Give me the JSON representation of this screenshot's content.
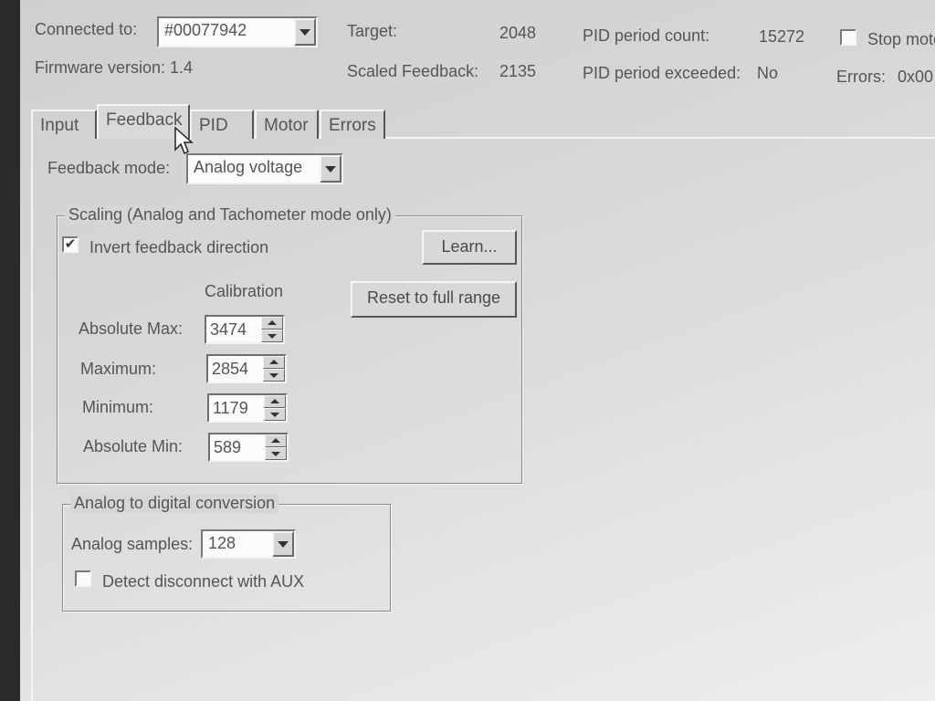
{
  "header": {
    "connected_label": "Connected to:",
    "device_serial": "#00077942",
    "firmware": "Firmware version: 1.4",
    "target_label": "Target:",
    "target_value": "2048",
    "scaled_label": "Scaled Feedback:",
    "scaled_value": "2135",
    "pid_count_label": "PID period count:",
    "pid_count_value": "15272",
    "pid_exceeded_label": "PID period exceeded:",
    "pid_exceeded_value": "No",
    "stop_label": "Stop moto",
    "errors_label": "Errors:",
    "errors_value": "0x00"
  },
  "tabs": [
    {
      "label": "Input"
    },
    {
      "label": "Feedback"
    },
    {
      "label": "PID"
    },
    {
      "label": "Motor"
    },
    {
      "label": "Errors"
    }
  ],
  "feedback": {
    "mode_label": "Feedback mode:",
    "mode_value": "Analog voltage",
    "scaling": {
      "caption": "Scaling (Analog and Tachometer mode only)",
      "invert_label": "Invert feedback direction",
      "invert_checked": true,
      "learn_button": "Learn...",
      "reset_button": "Reset to full range",
      "calibration_header": "Calibration",
      "rows": [
        {
          "label": "Absolute Max:",
          "value": "3474"
        },
        {
          "label": "Maximum:",
          "value": "2854"
        },
        {
          "label": "Minimum:",
          "value": "1179"
        },
        {
          "label": "Absolute Min:",
          "value": "589"
        }
      ]
    },
    "adc": {
      "caption": "Analog to digital conversion",
      "samples_label": "Analog samples:",
      "samples_value": "128",
      "detect_label": "Detect disconnect with AUX",
      "detect_checked": false
    }
  },
  "colors": {
    "panel": "#d6d6d6",
    "field": "#fbfbfb",
    "text": "#555555"
  }
}
